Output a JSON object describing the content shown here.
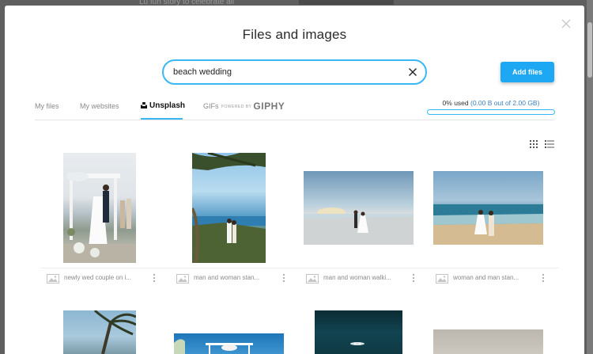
{
  "background": {
    "snippet": "Lu fun story to celebrate all"
  },
  "modal": {
    "title": "Files and images",
    "search": {
      "value": "beach wedding",
      "placeholder": ""
    },
    "add_button": "Add files",
    "tabs": [
      {
        "label": "My files",
        "active": false
      },
      {
        "label": "My websites",
        "active": false
      },
      {
        "label": "Unsplash",
        "active": true
      },
      {
        "label": "GIFs",
        "active": false,
        "powered_by": "POWERED BY",
        "brand": "GIPHY"
      }
    ],
    "storage": {
      "used": "0% used",
      "detail": "(0.00 B out of 2.00 GB)",
      "percent": 0
    },
    "images": [
      {
        "name": "newly wed couple on i..."
      },
      {
        "name": "man and woman stan..."
      },
      {
        "name": "man and woman walki..."
      },
      {
        "name": "woman and man stan..."
      },
      {
        "name": ""
      },
      {
        "name": ""
      },
      {
        "name": ""
      },
      {
        "name": ""
      }
    ]
  },
  "colors": {
    "accent": "#3ab7f5",
    "button": "#1ea7f2"
  }
}
